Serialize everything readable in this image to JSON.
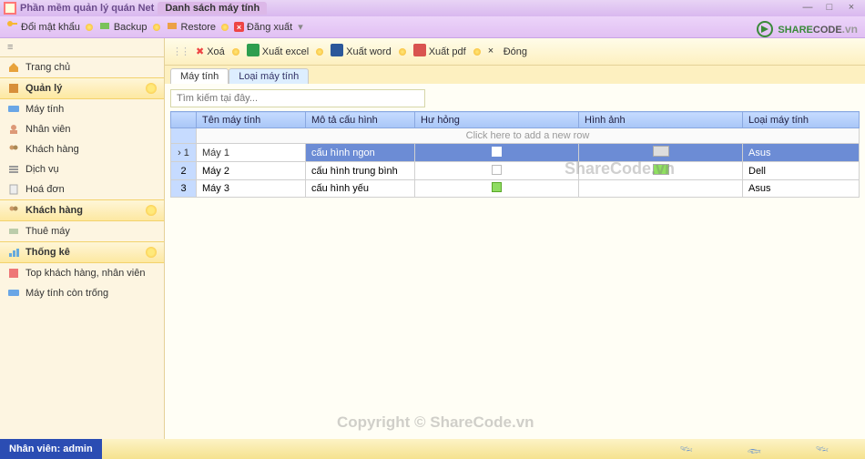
{
  "window": {
    "title": "Phần mềm quản lý quán Net",
    "tab": "Danh sách máy tính",
    "controls": {
      "min": "—",
      "max": "□",
      "close": "×"
    }
  },
  "mainmenu": {
    "items": [
      "Đổi mật khẩu",
      "Backup",
      "Restore",
      "Đăng xuất"
    ]
  },
  "sidebar": {
    "items": [
      {
        "label": "Trang chủ",
        "selected": false,
        "spark": false
      },
      {
        "label": "Quản lý",
        "selected": true,
        "spark": true
      },
      {
        "label": "Máy tính",
        "selected": false,
        "spark": false
      },
      {
        "label": "Nhân viên",
        "selected": false,
        "spark": false
      },
      {
        "label": "Khách hàng",
        "selected": false,
        "spark": false
      },
      {
        "label": "Dịch vụ",
        "selected": false,
        "spark": false
      },
      {
        "label": "Hoá đơn",
        "selected": false,
        "spark": false
      },
      {
        "label": "Khách hàng",
        "selected": true,
        "spark": true
      },
      {
        "label": "Thuê máy",
        "selected": false,
        "spark": false
      },
      {
        "label": "Thống kê",
        "selected": true,
        "spark": true
      },
      {
        "label": "Top khách hàng, nhân viên",
        "selected": false,
        "spark": false
      },
      {
        "label": "Máy tính còn trống",
        "selected": false,
        "spark": false
      }
    ]
  },
  "toolbar": {
    "delete": "Xoá",
    "excel": "Xuất excel",
    "word": "Xuất word",
    "pdf": "Xuất pdf",
    "close": "Đóng"
  },
  "tabs": {
    "t1": "Máy tính",
    "t2": "Loại máy tính"
  },
  "search": {
    "placeholder": "Tìm kiếm tại đây..."
  },
  "grid": {
    "cols": [
      "",
      "Tên máy tính",
      "Mô tả cấu hình",
      "Hư hỏng",
      "Hình ảnh",
      "Loại máy tính"
    ],
    "addrow": "Click here to add a new row",
    "rows": [
      {
        "idx": "1",
        "ten": "Máy 1",
        "mota": "cấu hình ngon",
        "loai": "Asus",
        "sel": true
      },
      {
        "idx": "2",
        "ten": "Máy 2",
        "mota": "cấu hình trung bình",
        "loai": "Dell",
        "sel": false
      },
      {
        "idx": "3",
        "ten": "Máy 3",
        "mota": "cấu hình yếu",
        "loai": "Asus",
        "sel": false
      }
    ]
  },
  "status": {
    "user": "Nhân viên: admin"
  },
  "branding": {
    "wm": "ShareCode.vn",
    "copy": "Copyright © ShareCode.vn",
    "logo1": "SHARE",
    "logo2": "CODE",
    "logo3": ".vn"
  }
}
